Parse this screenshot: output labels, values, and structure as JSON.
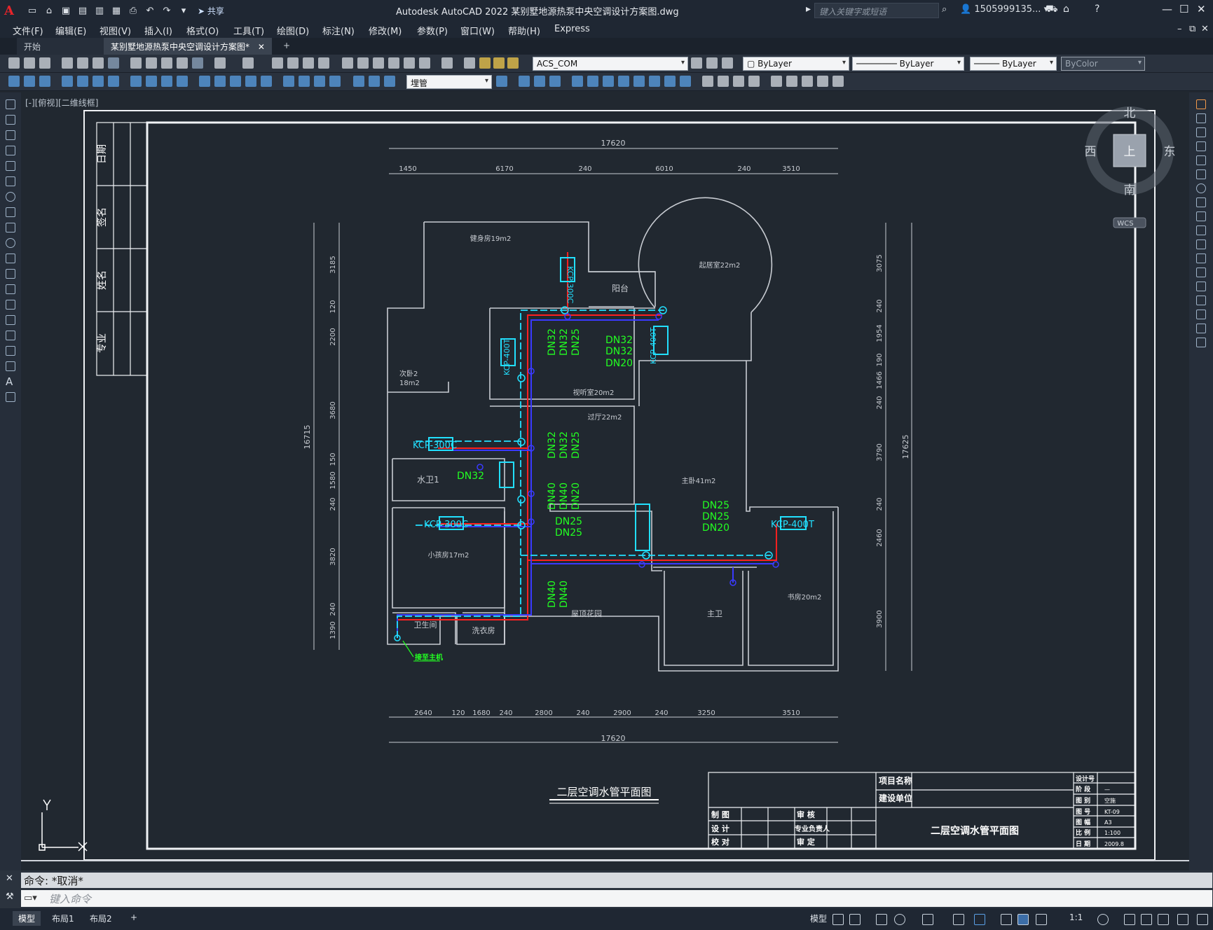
{
  "app": {
    "logo": "A",
    "title": "Autodesk AutoCAD 2022    某别墅地源热泵中央空调设计方案图.dwg",
    "share": "共享",
    "search_placeholder": "键入关键字或短语",
    "user": "1505999135...",
    "window_controls": [
      "—",
      "☐",
      "✕"
    ]
  },
  "menu": [
    "文件(F)",
    "编辑(E)",
    "视图(V)",
    "插入(I)",
    "格式(O)",
    "工具(T)",
    "绘图(D)",
    "标注(N)",
    "修改(M)",
    "参数(P)",
    "窗口(W)",
    "帮助(H)",
    "Express"
  ],
  "tabs": {
    "start": "开始",
    "doc": "某别墅地源热泵中央空调设计方案图*",
    "close": "✕",
    "add": "+"
  },
  "toolbar": {
    "layer": "ACS_COM",
    "color": "ByLayer",
    "linetype": "ByLayer",
    "lineweight": "ByLayer",
    "plotstyle": "ByColor",
    "style_combo": "埋管"
  },
  "viewport": {
    "label": "[-][俯视][二维线框]"
  },
  "viewcube": {
    "north": "北",
    "south": "南",
    "east": "东",
    "west": "西",
    "top": "上",
    "wcs": "WCS"
  },
  "drawing": {
    "sidebar_fields": [
      "日期",
      "签名",
      "姓名",
      "专业"
    ],
    "dims_top_total": "17620",
    "dims_top": [
      "1450",
      "6170",
      "240",
      "6010",
      "240",
      "3510"
    ],
    "dims_bottom_total": "17620",
    "dims_bottom": [
      "2640",
      "120",
      "1680",
      "240",
      "2800",
      "240",
      "2900",
      "240",
      "3250",
      "3510"
    ],
    "dims_left_total": "16715",
    "dims_left": [
      "3185",
      "120",
      "2200",
      "3680",
      "150",
      "1580",
      "240",
      "3820",
      "240",
      "1390"
    ],
    "dims_right_total": "17625",
    "dims_right": [
      "3075",
      "240",
      "1954",
      "190",
      "1466",
      "240",
      "3790",
      "240",
      "2460",
      "3900"
    ],
    "rooms": [
      "健身房19m2",
      "起居室22m2",
      "阳台",
      "次卧2",
      "18m2",
      "视听室20m2",
      "过厅22m2",
      "主卧41m2",
      "水卫1",
      "小孩房17m2",
      "卫生间",
      "洗衣房",
      "屋顶花园",
      "主卫",
      "书房20m2"
    ],
    "pipe_labels": [
      "DN32",
      "DN32",
      "DN25",
      "DN32",
      "DN32",
      "DN20",
      "DN32",
      "DN32",
      "DN25",
      "DN40",
      "DN40",
      "DN20",
      "DN25",
      "DN25",
      "DN25",
      "DN25",
      "DN20",
      "DN32",
      "DN40",
      "DN40"
    ],
    "unit_labels": [
      "KCP-300C",
      "KCP-400T",
      "KCP-300C",
      "KCP-400T",
      "KCP-400T"
    ],
    "riser_note": "接至主机",
    "plan_title": "二层空调水管平面图",
    "title_block": {
      "project_name": "项目名称",
      "build_unit": "建设单位",
      "roles": [
        "制 图",
        "设 计",
        "校 对"
      ],
      "approvals": [
        "审 核",
        "专业负责人",
        "审 定"
      ],
      "drawing_name": "二层空调水管平面图",
      "keys": [
        "设计号",
        "阶 段",
        "图 别",
        "图 号",
        "图 幅",
        "比 例",
        "日 期"
      ],
      "values": [
        "",
        "—",
        "空施",
        "KT-09",
        "A3",
        "1:100",
        "2009.8"
      ]
    }
  },
  "command": {
    "history": "命令: *取消*",
    "placeholder": "键入命令"
  },
  "status": {
    "tabs": [
      "模型",
      "布局1",
      "布局2"
    ],
    "model": "模型",
    "scale": "1:1"
  },
  "colors": {
    "pipe_supply": "#ff2020",
    "pipe_return": "#3a3aff",
    "dim_green": "#22ff22",
    "unit_cyan": "#22e0ff",
    "wall": "#c8ccd2"
  }
}
